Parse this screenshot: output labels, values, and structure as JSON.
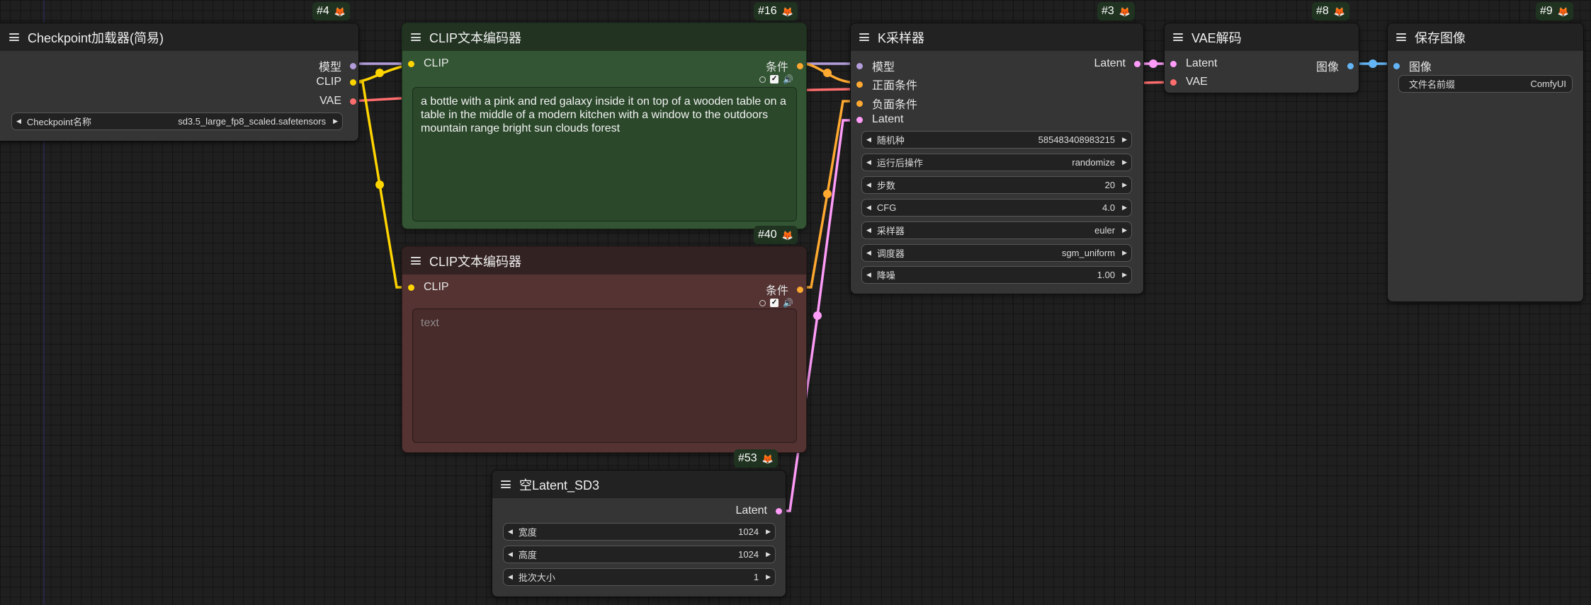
{
  "nodes": {
    "checkpoint": {
      "id": "#4",
      "title": "Checkpoint加载器(简易)",
      "outputs": [
        "模型",
        "CLIP",
        "VAE"
      ],
      "widgets": [
        {
          "label": "Checkpoint名称",
          "value": "sd3.5_large_fp8_scaled.safetensors"
        }
      ]
    },
    "clip_pos": {
      "id": "#16",
      "title": "CLIP文本编码器",
      "input": "CLIP",
      "output": "条件",
      "text": "a bottle with a pink and red galaxy inside it on top of a wooden table on a table in the middle of a modern kitchen with a window to the outdoors mountain range bright sun clouds forest"
    },
    "clip_neg": {
      "id": "#40",
      "title": "CLIP文本编码器",
      "input": "CLIP",
      "output": "条件",
      "text": "",
      "placeholder": "text"
    },
    "ksampler": {
      "id": "#3",
      "title": "K采样器",
      "inputs": [
        "模型",
        "正面条件",
        "负面条件",
        "Latent"
      ],
      "output": "Latent",
      "widgets": [
        {
          "label": "随机种",
          "value": "585483408983215"
        },
        {
          "label": "运行后操作",
          "value": "randomize"
        },
        {
          "label": "步数",
          "value": "20"
        },
        {
          "label": "CFG",
          "value": "4.0"
        },
        {
          "label": "采样器",
          "value": "euler"
        },
        {
          "label": "调度器",
          "value": "sgm_uniform"
        },
        {
          "label": "降噪",
          "value": "1.00"
        }
      ]
    },
    "vae_decode": {
      "id": "#8",
      "title": "VAE解码",
      "inputs": [
        "Latent",
        "VAE"
      ],
      "output": "图像"
    },
    "save_image": {
      "id": "#9",
      "title": "保存图像",
      "input": "图像",
      "widgets": [
        {
          "label": "文件名前缀",
          "value": "ComfyUI"
        }
      ]
    },
    "empty_latent": {
      "id": "#53",
      "title": "空Latent_SD3",
      "output": "Latent",
      "widgets": [
        {
          "label": "宽度",
          "value": "1024"
        },
        {
          "label": "高度",
          "value": "1024"
        },
        {
          "label": "批次大小",
          "value": "1"
        }
      ]
    }
  },
  "icons": {
    "badge": "fox-icon",
    "menu": "hamburger-menu-icon",
    "widget_arrows": "triangle-left-right-icons",
    "mini_toggles": "radio-checkbox-speaker-icons"
  },
  "colors": {
    "model": "#b39ddb",
    "clip": "#ffd500",
    "vae": "#ff6e6e",
    "conditioning": "#ffa931",
    "latent": "#ff9cf9",
    "image": "#64b5f6",
    "positive_node": "#335533",
    "negative_node": "#553333"
  }
}
